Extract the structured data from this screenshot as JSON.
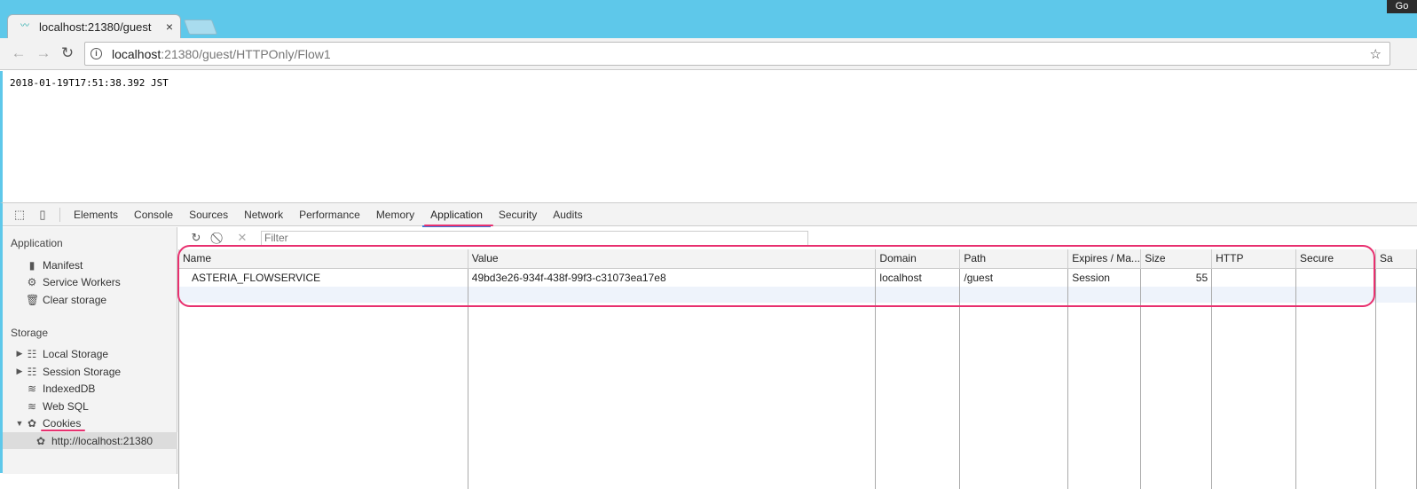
{
  "browser": {
    "tab_title": "localhost:21380/guest",
    "tab_close": "×",
    "go_button": "Go",
    "url_host": "localhost",
    "url_rest": ":21380/guest/HTTPOnly/Flow1"
  },
  "page": {
    "timestamp": "2018-01-19T17:51:38.392 JST"
  },
  "devtools": {
    "tabs": [
      "Elements",
      "Console",
      "Sources",
      "Network",
      "Performance",
      "Memory",
      "Application",
      "Security",
      "Audits"
    ],
    "active_tab": "Application",
    "sidebar": {
      "application_heading": "Application",
      "application_items": [
        "Manifest",
        "Service Workers",
        "Clear storage"
      ],
      "storage_heading": "Storage",
      "storage_items": [
        "Local Storage",
        "Session Storage",
        "IndexedDB",
        "Web SQL",
        "Cookies"
      ],
      "cookie_origin": "http://localhost:21380"
    },
    "filter_placeholder": "Filter",
    "table": {
      "columns": [
        "Name",
        "Value",
        "Domain",
        "Path",
        "Expires / Ma...",
        "Size",
        "HTTP",
        "Secure",
        "Sa"
      ],
      "rows": [
        [
          "ASTERIA_FLOWSERVICE",
          "49bd3e26-934f-438f-99f3-c31073ea17e8",
          "localhost",
          "/guest",
          "Session",
          "55",
          "",
          "",
          ""
        ]
      ]
    },
    "annotation_color": "#e8306f"
  }
}
